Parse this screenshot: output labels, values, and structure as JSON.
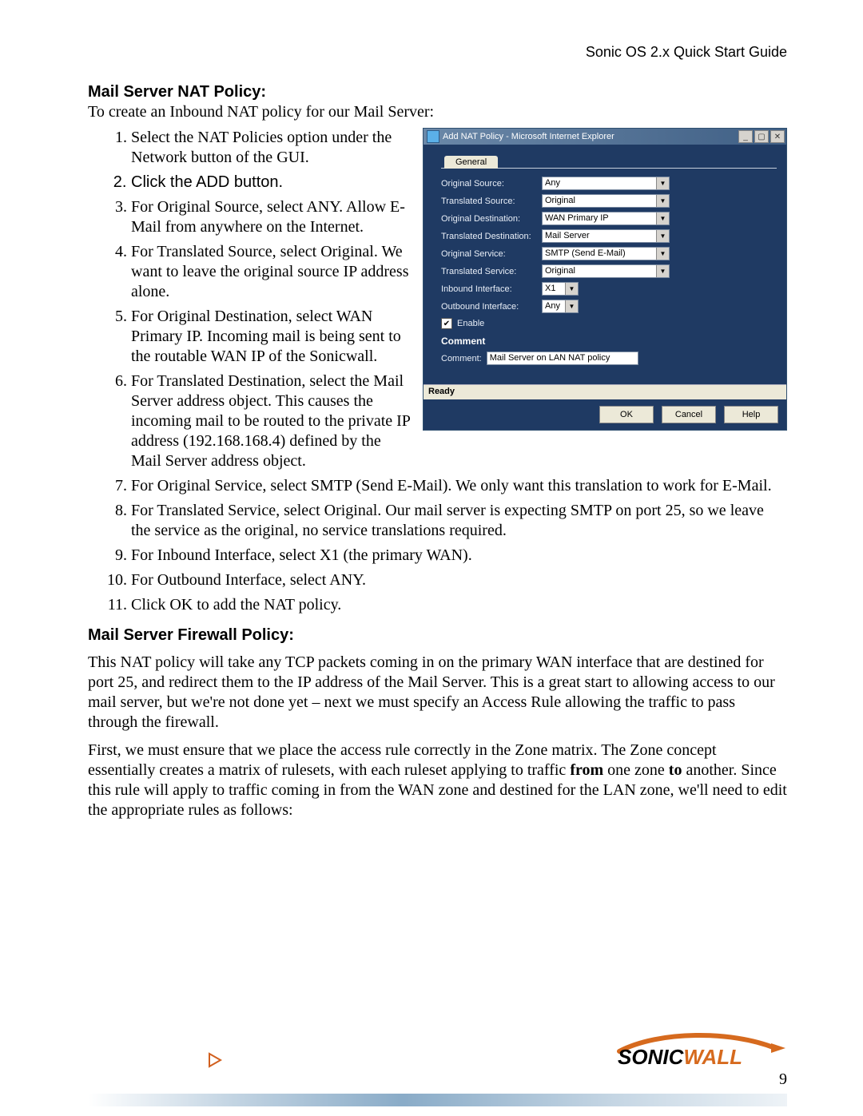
{
  "header": {
    "doc_title": "Sonic OS 2.x Quick Start Guide"
  },
  "sections": {
    "nat_heading": "Mail Server NAT Policy:",
    "nat_intro": "To create an Inbound NAT policy for our Mail Server:",
    "fw_heading": "Mail Server Firewall Policy:"
  },
  "steps": {
    "s1": "Select the NAT Policies option under the Network button of the GUI.",
    "s2": "Click the ADD button.",
    "s3": "For Original Source, select ANY. Allow E-Mail from anywhere on the Internet.",
    "s4": "For Translated Source, select Original. We want to leave the original source IP address alone.",
    "s5": "For Original Destination, select WAN Primary IP. Incoming mail is being sent to the routable WAN IP of the Sonicwall.",
    "s6": "For Translated Destination, select the Mail Server address object. This causes the incoming mail to be routed to the private IP address (192.168.168.4) defined by the Mail Server address object.",
    "s7": "For Original Service, select SMTP (Send E-Mail). We only want this translation to work for E-Mail.",
    "s8": "For Translated Service, select Original. Our mail server is expecting SMTP on port 25, so we leave the service as the original, no service translations required.",
    "s9": "For Inbound Interface, select X1 (the primary WAN).",
    "s10": "For Outbound Interface, select ANY.",
    "s11": "Click OK to add the NAT policy."
  },
  "fw_paras": {
    "p1": "This NAT policy will take any TCP packets coming in on the primary WAN interface that are destined for port 25, and redirect them to the IP address of the Mail Server. This is a great start to allowing access to our mail server, but we're not done yet – next we must specify an Access Rule allowing the traffic to pass through the firewall.",
    "p2a": "First, we must ensure that we place the access rule correctly in the Zone matrix. The Zone concept essentially creates a matrix of rulesets, with each ruleset applying to traffic ",
    "p2b_from": "from",
    "p2c": " one zone ",
    "p2d_to": "to",
    "p2e": " another. Since this rule will apply to traffic coming in from the WAN zone and destined for the LAN zone, we'll need to edit the appropriate rules as follows:"
  },
  "dialog": {
    "title": "Add NAT Policy - Microsoft Internet Explorer",
    "tab": "General",
    "labels": {
      "orig_src": "Original Source:",
      "trans_src": "Translated Source:",
      "orig_dst": "Original Destination:",
      "trans_dst": "Translated Destination:",
      "orig_svc": "Original Service:",
      "trans_svc": "Translated Service:",
      "in_if": "Inbound Interface:",
      "out_if": "Outbound Interface:",
      "enable": "Enable",
      "comment_head": "Comment",
      "comment_label": "Comment:"
    },
    "values": {
      "orig_src": "Any",
      "trans_src": "Original",
      "orig_dst": "WAN Primary IP",
      "trans_dst": "Mail Server",
      "orig_svc": "SMTP (Send E-Mail)",
      "trans_svc": "Original",
      "in_if": "X1",
      "out_if": "Any",
      "comment": "Mail Server on LAN NAT policy"
    },
    "status": "Ready",
    "buttons": {
      "ok": "OK",
      "cancel": "Cancel",
      "help": "Help"
    }
  },
  "footer": {
    "brand_a": "SONIC",
    "brand_b": "WALL",
    "page_number": "9"
  }
}
